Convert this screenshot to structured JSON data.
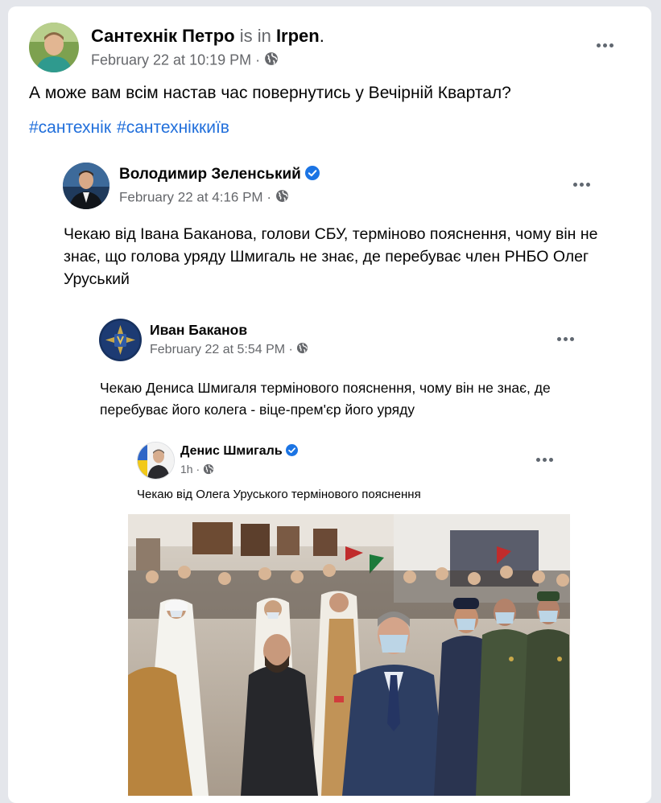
{
  "post": {
    "author": "Сантехнік Петро",
    "is_in": " is in ",
    "location": "Irpen",
    "period": ".",
    "date": "February 22 at 10:19 PM",
    "separator": " · ",
    "text": "А може вам всім настав час повернутись у Вечірній Квартал?",
    "hashtags": [
      "#сантехнік",
      "#сантехніккиїв"
    ]
  },
  "shared1": {
    "author": "Володимир Зеленський",
    "date": "February 22 at 4:16 PM",
    "separator": " · ",
    "text": "Чекаю від Івана Баканова, голови СБУ, терміново пояснення, чому він не знає, що голова уряду Шмигаль не знає, де перебуває член РНБО Олег Уруський"
  },
  "shared2": {
    "author": "Иван Баканов",
    "date": "February 22 at 5:54 PM",
    "separator": " · ",
    "text": "Чекаю Дениса Шмигаля термінового пояснення, чому він не знає, де перебуває його колега - віце-прем'єр його уряду"
  },
  "shared3": {
    "author": "Денис Шмигаль",
    "date": "1h",
    "separator": " · ",
    "text": "Чекаю від Олега Уруського термінового пояснення"
  },
  "colors": {
    "link": "#216fdb",
    "verified": "#1b74e4",
    "meta": "#65676b",
    "background": "#e4e6eb"
  },
  "icons": [
    "globe-icon",
    "verified-badge-icon",
    "more-options-icon"
  ]
}
